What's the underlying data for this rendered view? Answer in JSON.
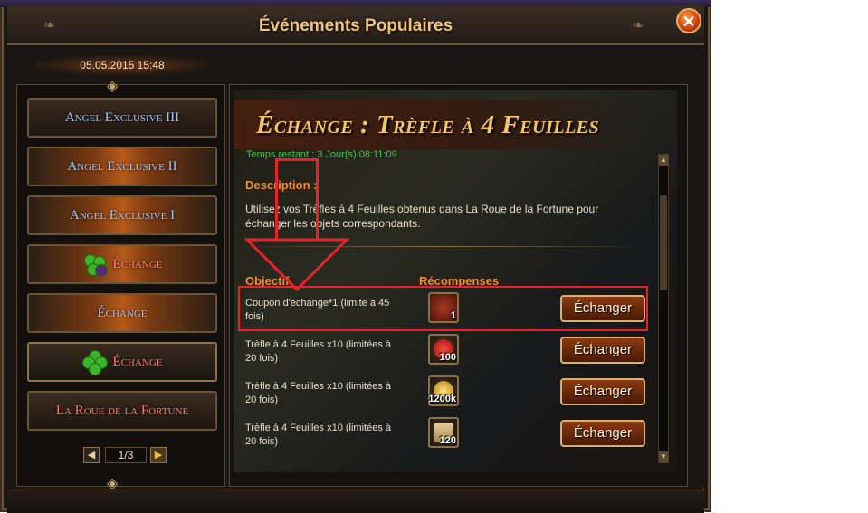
{
  "window": {
    "title": "Événements Populaires",
    "close_label": "✕"
  },
  "date": "05.05.2015 15:48",
  "sidebar": {
    "items": [
      {
        "label": "Angel Exclusive III",
        "color": "#9fc6ff"
      },
      {
        "label": "Angel Exclusive II",
        "color": "#9fc6ff"
      },
      {
        "label": "Angel Exclusive I",
        "color": "#9fc6ff"
      },
      {
        "label": "Échange",
        "color": "#ff7b6a",
        "icon": "clover-bouquet-icon"
      },
      {
        "label": "Échange",
        "color": "#9fc6ff"
      },
      {
        "label": "Échange",
        "color": "#ff7b6a",
        "icon": "four-leaf-clover-icon"
      },
      {
        "label": "La Roue de la Fortune",
        "color": "#ff7b6a"
      }
    ],
    "pager": {
      "current": "1/3",
      "prev_icon": "left-arrow-icon",
      "next_icon": "right-arrow-icon"
    }
  },
  "event": {
    "title": "Échange : Trèfle à 4 Feuilles",
    "time_left": "Temps restant : 3 Jour(s)  08:11:09",
    "description_title": "Description :",
    "description_text": "Utilisez vos Trèfles à 4 Feuilles obtenus dans La Roue de la Fortune pour échanger les objets correspondants.",
    "col_objective": "Objectif",
    "col_rewards": "Récompenses",
    "rows": [
      {
        "objective": "Coupon d'échange*1 (limite à 45 fois)",
        "reward_label": "1",
        "reward_icon": "coupon-icon",
        "button": "Échanger"
      },
      {
        "objective": "Trèfle à 4 Feuilles x10 (limitées à 20 fois)",
        "reward_label": "100",
        "reward_icon": "red-flowers-icon",
        "button": "Échanger"
      },
      {
        "objective": "Trèfle à 4 Feuilles x10 (limitées à 20 fois)",
        "reward_label": "1200k",
        "reward_icon": "gold-coin-icon",
        "button": "Échanger"
      },
      {
        "objective": "Trèfle à 4 Feuilles x10 (limitées à 20 fois)",
        "reward_label": "120",
        "reward_icon": "scroll-icon",
        "button": "Échanger"
      }
    ]
  },
  "colors": {
    "accent_orange": "#f38b2e",
    "highlight_red": "#e4232b",
    "time_green": "#47c447",
    "title_gold": "#f6c569"
  }
}
